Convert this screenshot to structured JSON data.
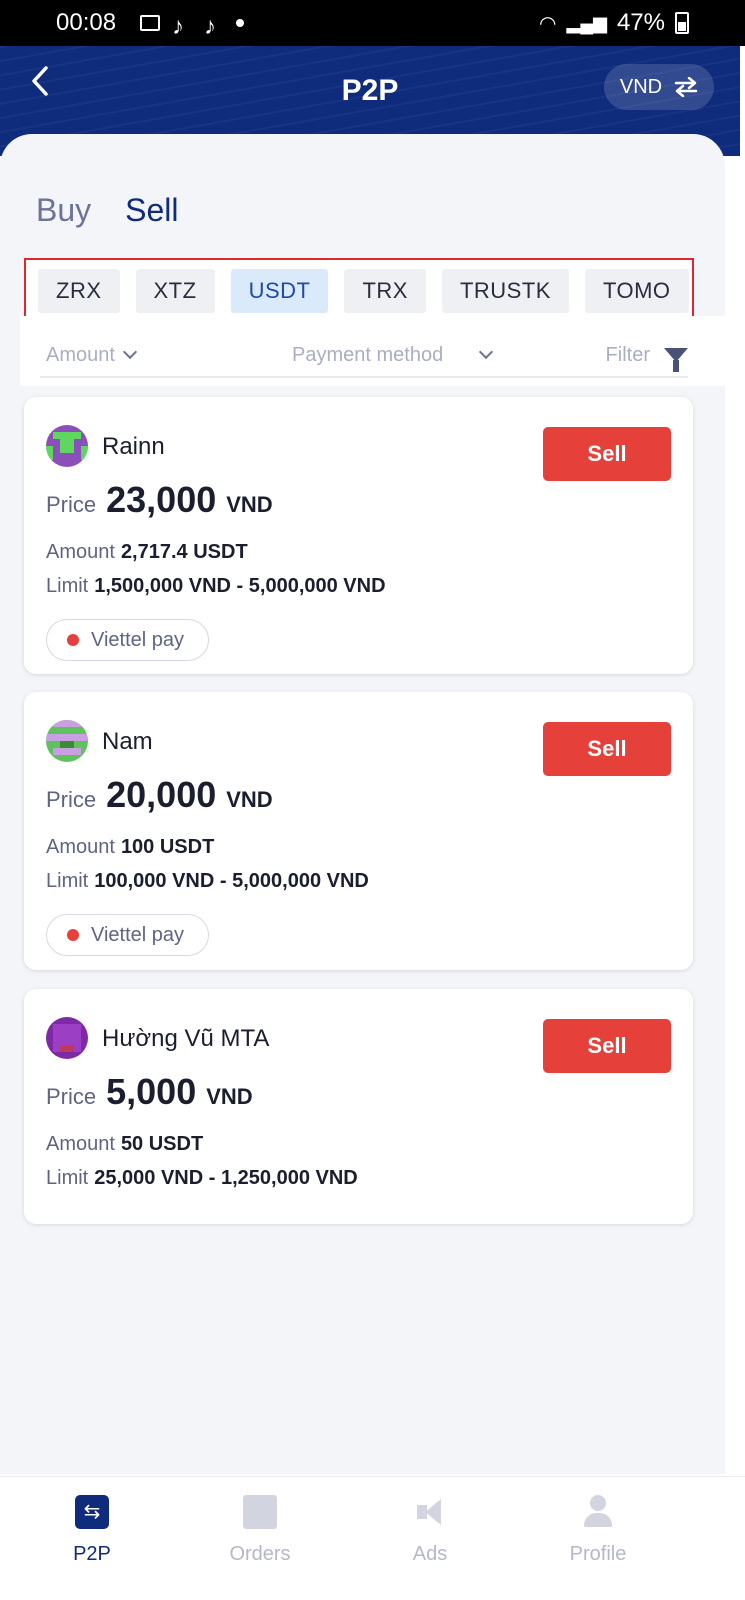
{
  "status_bar": {
    "time": "00:08",
    "battery": "47%"
  },
  "header": {
    "title": "P2P",
    "currency": "VND",
    "back_icon": "chevron-left-icon",
    "swap_icon": "swap-icon"
  },
  "tabs": {
    "buy": "Buy",
    "sell": "Sell",
    "selected": "Sell"
  },
  "coins": [
    {
      "label": "ZRX",
      "active": false
    },
    {
      "label": "XTZ",
      "active": false
    },
    {
      "label": "USDT",
      "active": true
    },
    {
      "label": "TRX",
      "active": false
    },
    {
      "label": "TRUSTK",
      "active": false
    },
    {
      "label": "TOMO",
      "active": false
    }
  ],
  "filters": {
    "amount": "Amount",
    "payment_method": "Payment method",
    "filter": "Filter"
  },
  "offers": [
    {
      "name": "Rainn",
      "price_label": "Price",
      "price": "23,000",
      "price_currency": "VND",
      "amount_label": "Amount",
      "amount": "2,717.4 USDT",
      "limit_label": "Limit",
      "limit": "1,500,000 VND - 5,000,000 VND",
      "payment": "Viettel pay",
      "action": "Sell"
    },
    {
      "name": "Nam",
      "price_label": "Price",
      "price": "20,000",
      "price_currency": "VND",
      "amount_label": "Amount",
      "amount": "100 USDT",
      "limit_label": "Limit",
      "limit": "100,000 VND - 5,000,000 VND",
      "payment": "Viettel pay",
      "action": "Sell"
    },
    {
      "name": "Hường Vũ MTA",
      "price_label": "Price",
      "price": "5,000",
      "price_currency": "VND",
      "amount_label": "Amount",
      "amount": "50 USDT",
      "limit_label": "Limit",
      "limit": "25,000 VND - 1,250,000 VND",
      "payment": "",
      "action": "Sell"
    }
  ],
  "bottom_nav": [
    {
      "label": "P2P",
      "icon": "p2p-icon",
      "active": true
    },
    {
      "label": "Orders",
      "icon": "orders-icon",
      "active": false
    },
    {
      "label": "Ads",
      "icon": "megaphone-icon",
      "active": false
    },
    {
      "label": "Profile",
      "icon": "profile-icon",
      "active": false
    }
  ],
  "colors": {
    "primary": "#0f2b7c",
    "sell": "#e6403a",
    "highlight_border": "#e0272d",
    "active_coin_bg": "#dbeafb"
  }
}
